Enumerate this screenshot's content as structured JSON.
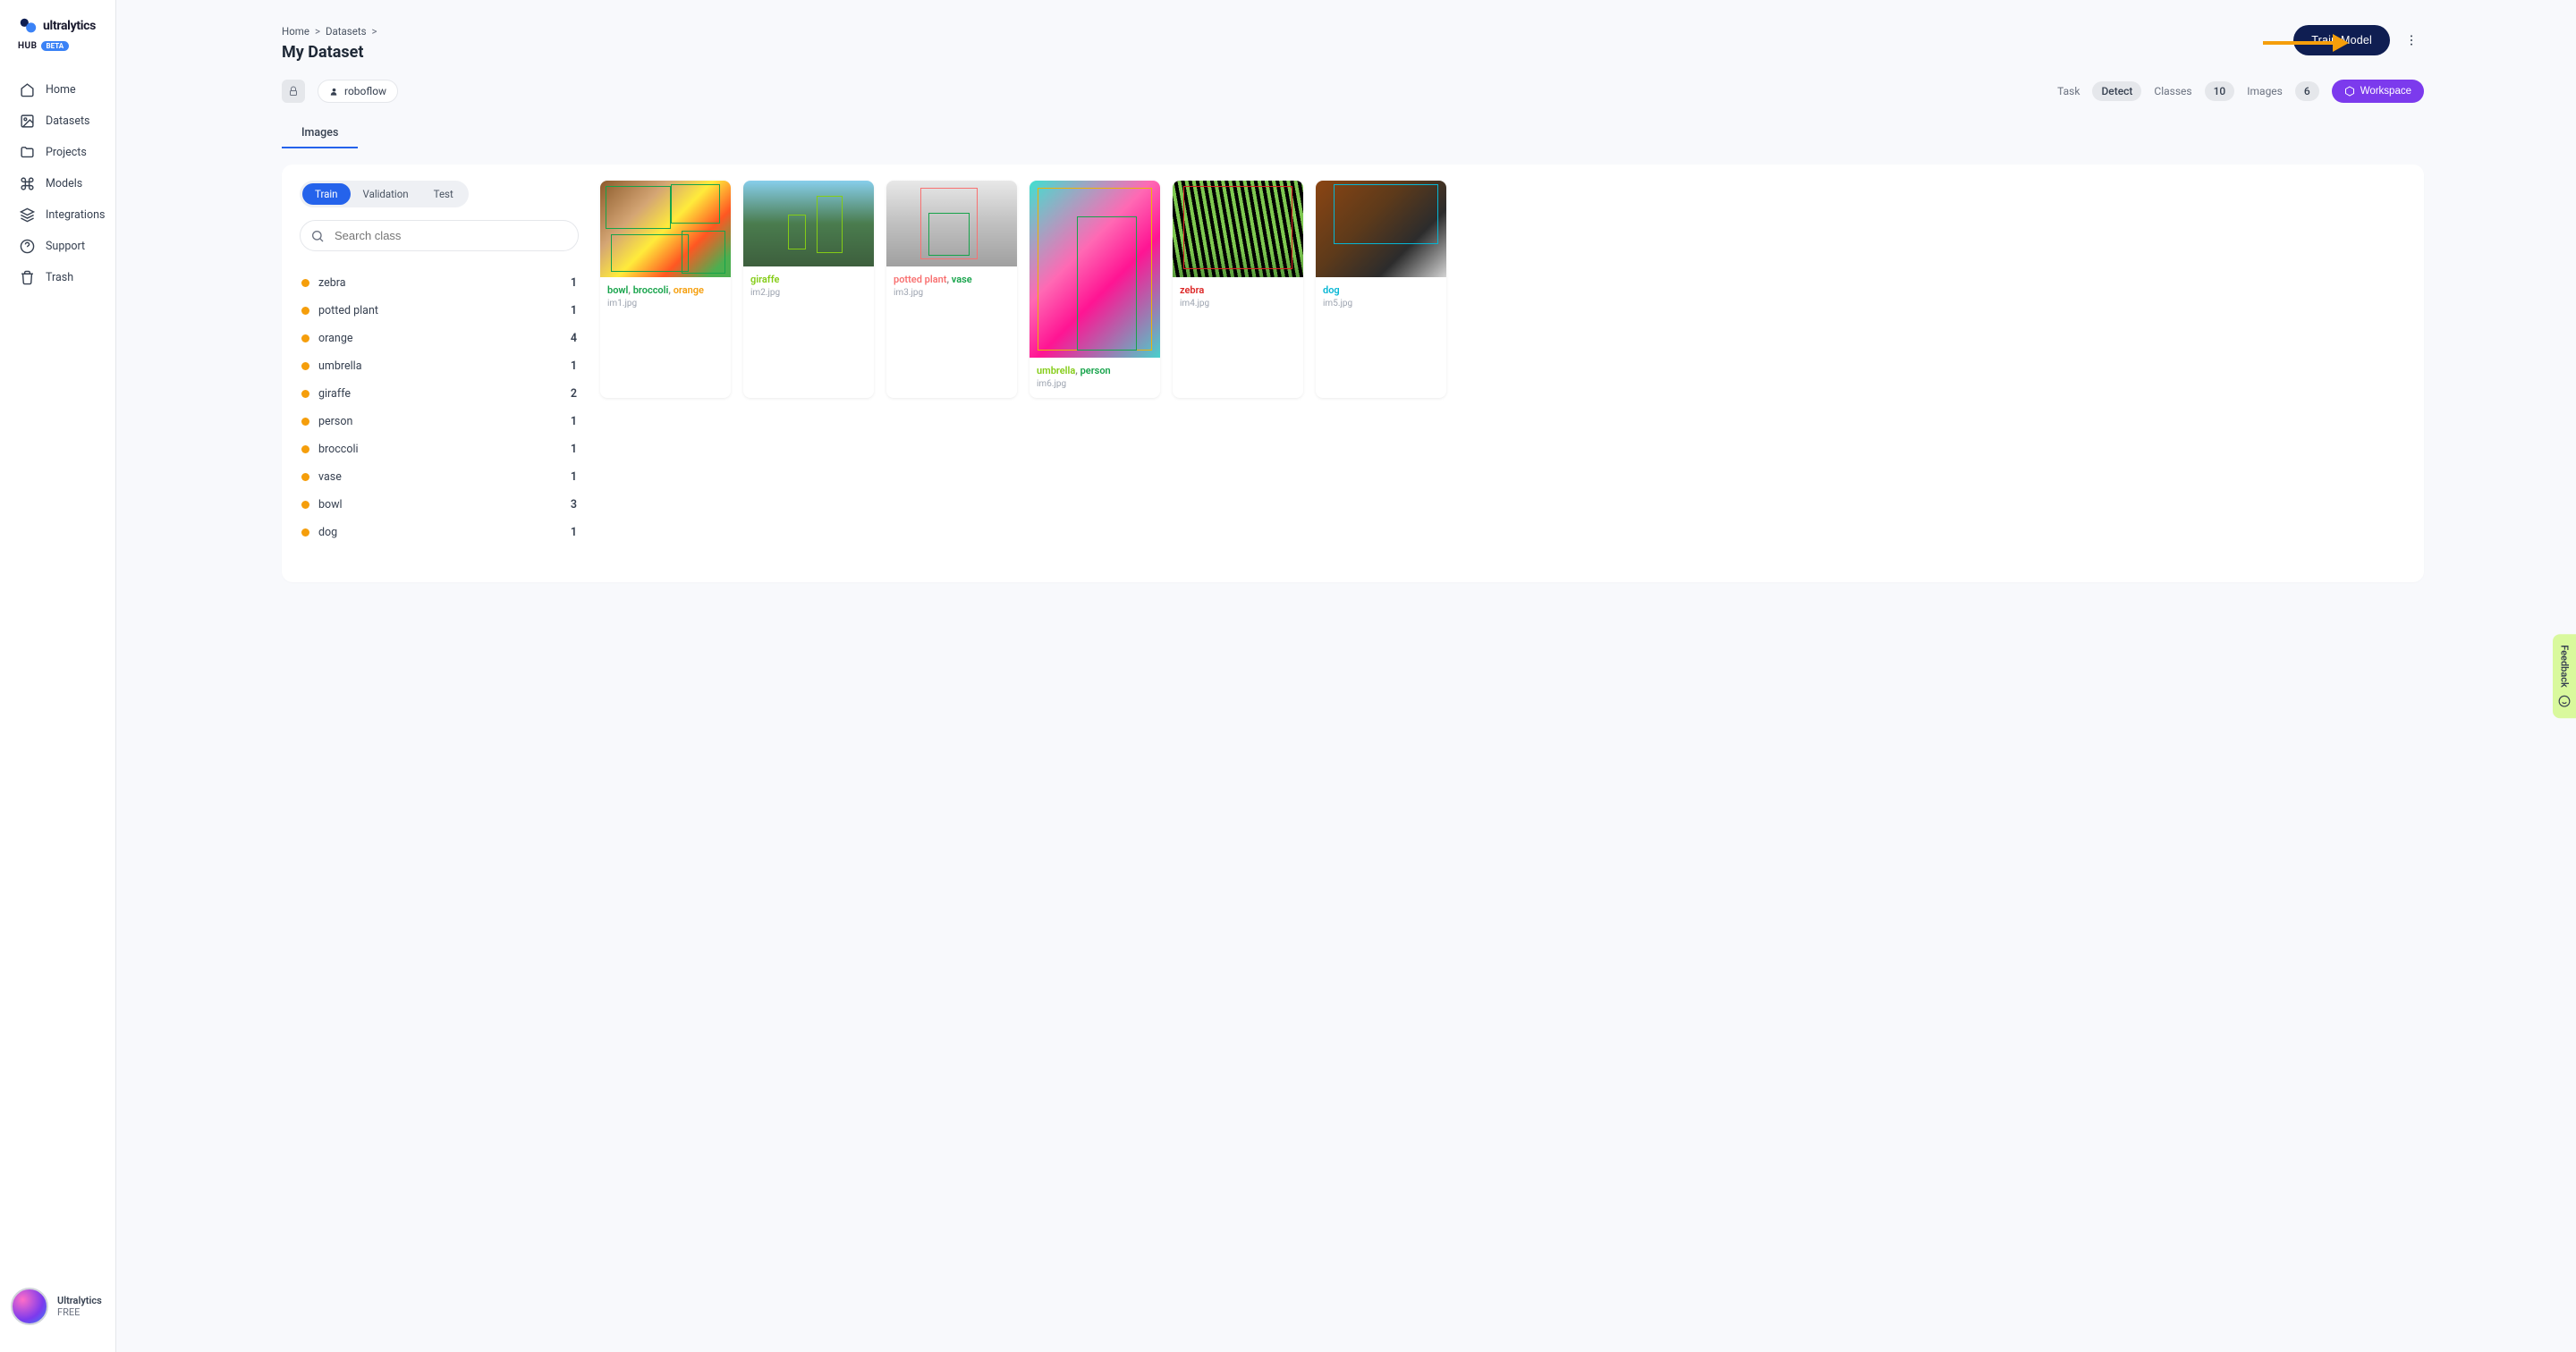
{
  "brand": {
    "name": "ultralytics",
    "sub": "HUB",
    "beta": "BETA"
  },
  "sidebar": {
    "items": [
      {
        "label": "Home"
      },
      {
        "label": "Datasets"
      },
      {
        "label": "Projects"
      },
      {
        "label": "Models"
      },
      {
        "label": "Integrations"
      },
      {
        "label": "Support"
      },
      {
        "label": "Trash"
      }
    ],
    "footer": {
      "line1": "Ultralytics",
      "line2": "FREE"
    }
  },
  "breadcrumb": {
    "home": "Home",
    "sep": ">",
    "datasets": "Datasets"
  },
  "page": {
    "title": "My Dataset"
  },
  "actions": {
    "train": "Train Model",
    "workspace": "Workspace"
  },
  "owner": {
    "name": "roboflow"
  },
  "stats": {
    "taskLabel": "Task",
    "task": "Detect",
    "classesLabel": "Classes",
    "classesCount": "10",
    "imagesLabel": "Images",
    "imagesCount": "6"
  },
  "tabs": {
    "images": "Images"
  },
  "splitTabs": {
    "train": "Train",
    "validation": "Validation",
    "test": "Test"
  },
  "search": {
    "placeholder": "Search class"
  },
  "classes": [
    {
      "name": "zebra",
      "count": "1"
    },
    {
      "name": "potted plant",
      "count": "1"
    },
    {
      "name": "orange",
      "count": "4"
    },
    {
      "name": "umbrella",
      "count": "1"
    },
    {
      "name": "giraffe",
      "count": "2"
    },
    {
      "name": "person",
      "count": "1"
    },
    {
      "name": "broccoli",
      "count": "1"
    },
    {
      "name": "vase",
      "count": "1"
    },
    {
      "name": "bowl",
      "count": "3"
    },
    {
      "name": "dog",
      "count": "1"
    }
  ],
  "images": {
    "im1": {
      "file": "im1.jpg",
      "labels": [
        {
          "t": "bowl",
          "c": "#16a34a"
        },
        {
          "t": ", ",
          "c": "#888"
        },
        {
          "t": "broccoli",
          "c": "#16a34a"
        },
        {
          "t": ", ",
          "c": "#888"
        },
        {
          "t": "orange",
          "c": "#f59e0b"
        }
      ]
    },
    "im2": {
      "file": "im2.jpg",
      "labels": [
        {
          "t": "giraffe",
          "c": "#84cc16"
        }
      ]
    },
    "im3": {
      "file": "im3.jpg",
      "labels": [
        {
          "t": "potted plant",
          "c": "#f87171"
        },
        {
          "t": ", ",
          "c": "#888"
        },
        {
          "t": "vase",
          "c": "#16a34a"
        }
      ]
    },
    "im4": {
      "file": "im4.jpg",
      "labels": [
        {
          "t": "zebra",
          "c": "#dc2626"
        }
      ]
    },
    "im5": {
      "file": "im5.jpg",
      "labels": [
        {
          "t": "dog",
          "c": "#06b6d4"
        }
      ]
    },
    "im6": {
      "file": "im6.jpg",
      "labels": [
        {
          "t": "umbrella",
          "c": "#84cc16"
        },
        {
          "t": ", ",
          "c": "#888"
        },
        {
          "t": "person",
          "c": "#16a34a"
        }
      ]
    }
  },
  "feedback": {
    "label": "Feedback"
  }
}
